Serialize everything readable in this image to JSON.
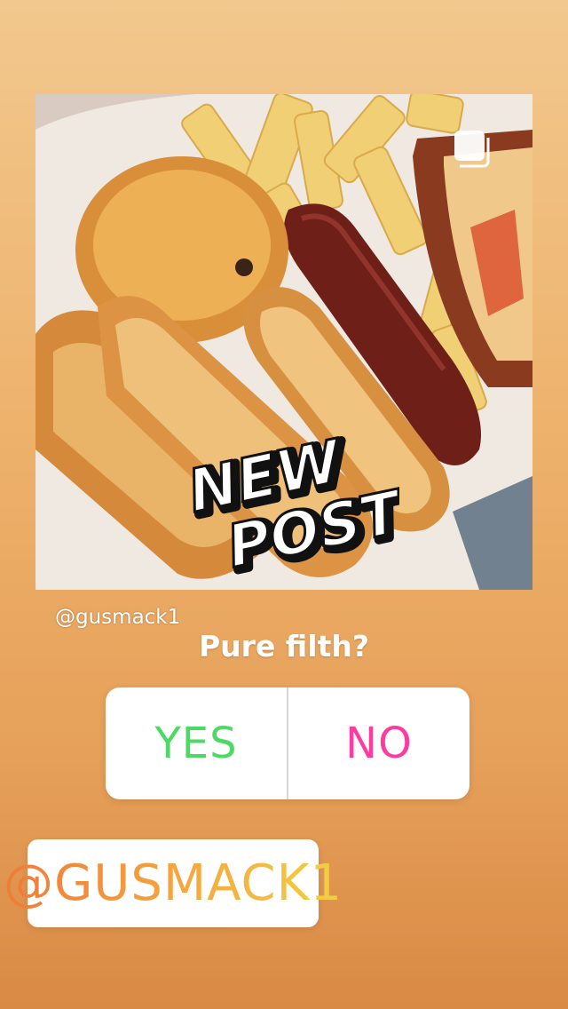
{
  "story": {
    "username": "@gusmack1",
    "sticker_text": "NEW POST!",
    "sticker_line1": "NEW",
    "sticker_line2": "POST!"
  },
  "poll": {
    "question": "Pure filth?",
    "options": [
      {
        "label": "YES",
        "color": "#4cd964"
      },
      {
        "label": "NO",
        "color": "#ff3aa0"
      }
    ]
  },
  "mention": {
    "label": "@GUSMACK1"
  },
  "icons": {
    "post_icon": "square-post-icon"
  }
}
